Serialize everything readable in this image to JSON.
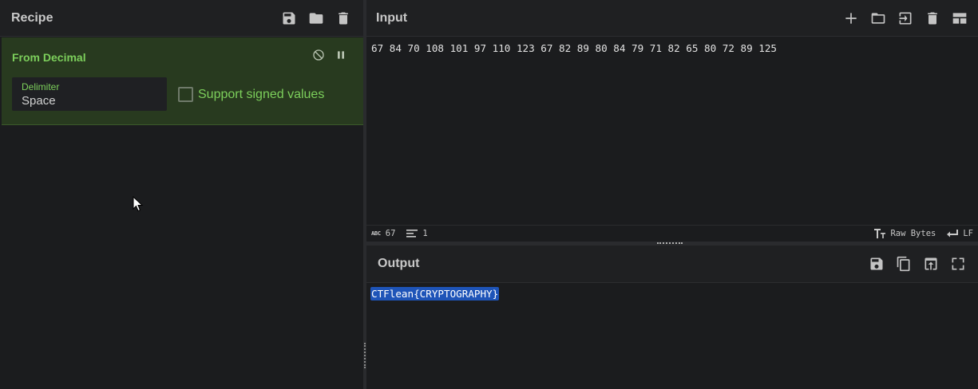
{
  "recipe": {
    "title": "Recipe",
    "operation": {
      "name": "From Decimal",
      "delimiter_label": "Delimiter",
      "delimiter_value": "Space",
      "signed_label": "Support signed values",
      "signed_checked": false
    }
  },
  "input": {
    "title": "Input",
    "text": "67 84 70 108 101 97 110 123 67 82 89 80 84 79 71 82 65 80 72 89 125",
    "status": {
      "length": "67",
      "lines": "1",
      "encoding": "Raw Bytes",
      "eol": "LF"
    }
  },
  "output": {
    "title": "Output",
    "text": "CTFlean{CRYPTOGRAPHY}"
  },
  "colors": {
    "background": "#1b1c1e",
    "operation_bg": "#283a1f",
    "accent_green": "#7ccf5b",
    "selection_blue": "#1e54b8"
  },
  "icons": {
    "recipe_header": [
      "save-icon",
      "folder-icon",
      "trash-icon"
    ],
    "input_header": [
      "plus-icon",
      "folder-icon",
      "import-icon",
      "trash-icon",
      "layout-icon"
    ],
    "output_header": [
      "save-icon",
      "copy-icon",
      "replace-input-icon",
      "maximize-icon"
    ]
  }
}
